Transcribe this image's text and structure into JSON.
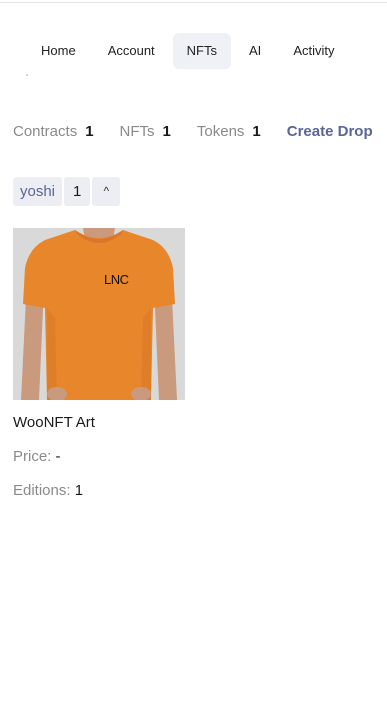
{
  "nav": {
    "items": [
      {
        "label": "Home",
        "active": false
      },
      {
        "label": "Account",
        "active": false
      },
      {
        "label": "NFTs",
        "active": true
      },
      {
        "label": "AI",
        "active": false
      },
      {
        "label": "Activity",
        "active": false
      }
    ]
  },
  "stats": {
    "contracts_label": "Contracts",
    "contracts_value": "1",
    "nfts_label": "NFTs",
    "nfts_value": "1",
    "tokens_label": "Tokens",
    "tokens_value": "1",
    "create_drop": "Create Drop"
  },
  "filter": {
    "name": "yoshi",
    "count": "1",
    "toggle_icon": "chevron-up-icon",
    "toggle_glyph": "^"
  },
  "card": {
    "image_text": "LNC",
    "image_colors": {
      "shirt": "#e8862c",
      "background": "#d9d9d9",
      "skin": "#c99a7e"
    },
    "title": "WooNFT Art",
    "price_label": "Price:",
    "price_value": "-",
    "editions_label": "Editions:",
    "editions_value": "1"
  },
  "colors": {
    "accent": "#5a6599",
    "chip_bg": "#eceef4",
    "active_tab_bg": "#eef1f6",
    "muted_text": "#8a8a8a"
  }
}
